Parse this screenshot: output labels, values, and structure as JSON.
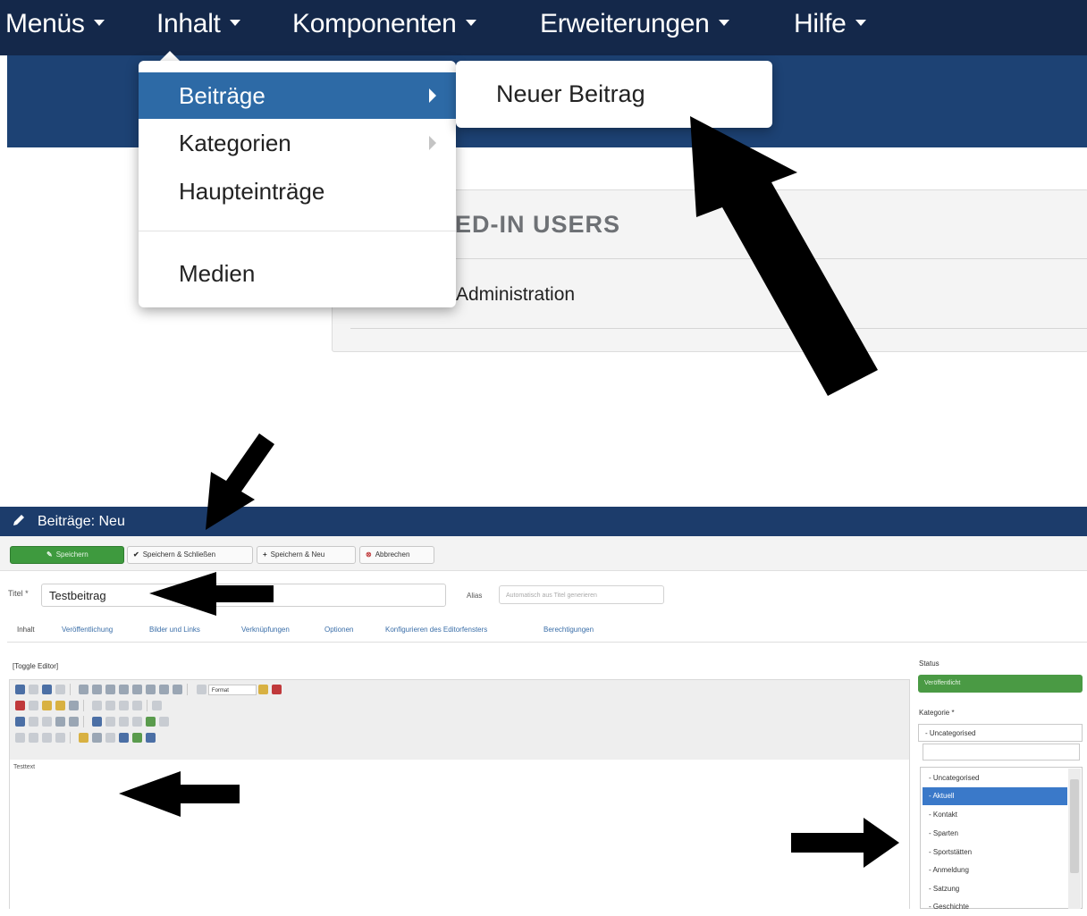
{
  "top_nav": {
    "items": [
      {
        "label": "Menüs"
      },
      {
        "label": "Inhalt"
      },
      {
        "label": "Komponenten"
      },
      {
        "label": "Erweiterungen"
      },
      {
        "label": "Hilfe"
      }
    ]
  },
  "dropdown": {
    "items": [
      {
        "label": "Beiträge",
        "active": true,
        "has_submenu": true
      },
      {
        "label": "Kategorien",
        "active": false,
        "has_submenu": true
      },
      {
        "label": "Haupteinträge",
        "active": false,
        "has_submenu": false
      },
      {
        "label": "Medien",
        "active": false,
        "has_submenu": false
      }
    ],
    "submenu_item": "Neuer Beitrag"
  },
  "panel": {
    "heading": "ED-IN USERS",
    "row": "Administration"
  },
  "editor": {
    "title": "Beiträge: Neu",
    "toolbar": {
      "save": "Speichern",
      "save_close": "Speichern & Schließen",
      "save_new": "Speichern & Neu",
      "cancel": "Abbrechen"
    },
    "title_label": "Titel *",
    "title_value": "Testbeitrag",
    "alias_label": "Alias",
    "alias_placeholder": "Automatisch aus Titel generieren",
    "tabs": [
      "Inhalt",
      "Veröffentlichung",
      "Bilder und Links",
      "Verknüpfungen",
      "Optionen",
      "Konfigurieren des Editorfensters",
      "Berechtigungen"
    ],
    "toggle_editor": "[Toggle Editor]",
    "format_select": "Format",
    "content_text": "Testtext",
    "status_label": "Status",
    "status_value": "Veröffentlicht",
    "category_label": "Kategorie *",
    "category_value": "- Uncategorised",
    "category_options": [
      {
        "label": "- Uncategorised",
        "selected": false
      },
      {
        "label": "- Aktuell",
        "selected": true
      },
      {
        "label": "- Kontakt",
        "selected": false
      },
      {
        "label": "- Sparten",
        "selected": false
      },
      {
        "label": "- Sportstätten",
        "selected": false
      },
      {
        "label": "- Anmeldung",
        "selected": false
      },
      {
        "label": "- Satzung",
        "selected": false
      },
      {
        "label": "- Geschichte",
        "selected": false
      }
    ]
  },
  "colors": {
    "nav_bg": "#14284a",
    "subbar_bg": "#1d4274",
    "active_menu": "#2d6aa6",
    "save_green": "#3e9a3e",
    "selected_option": "#3a79c9"
  }
}
